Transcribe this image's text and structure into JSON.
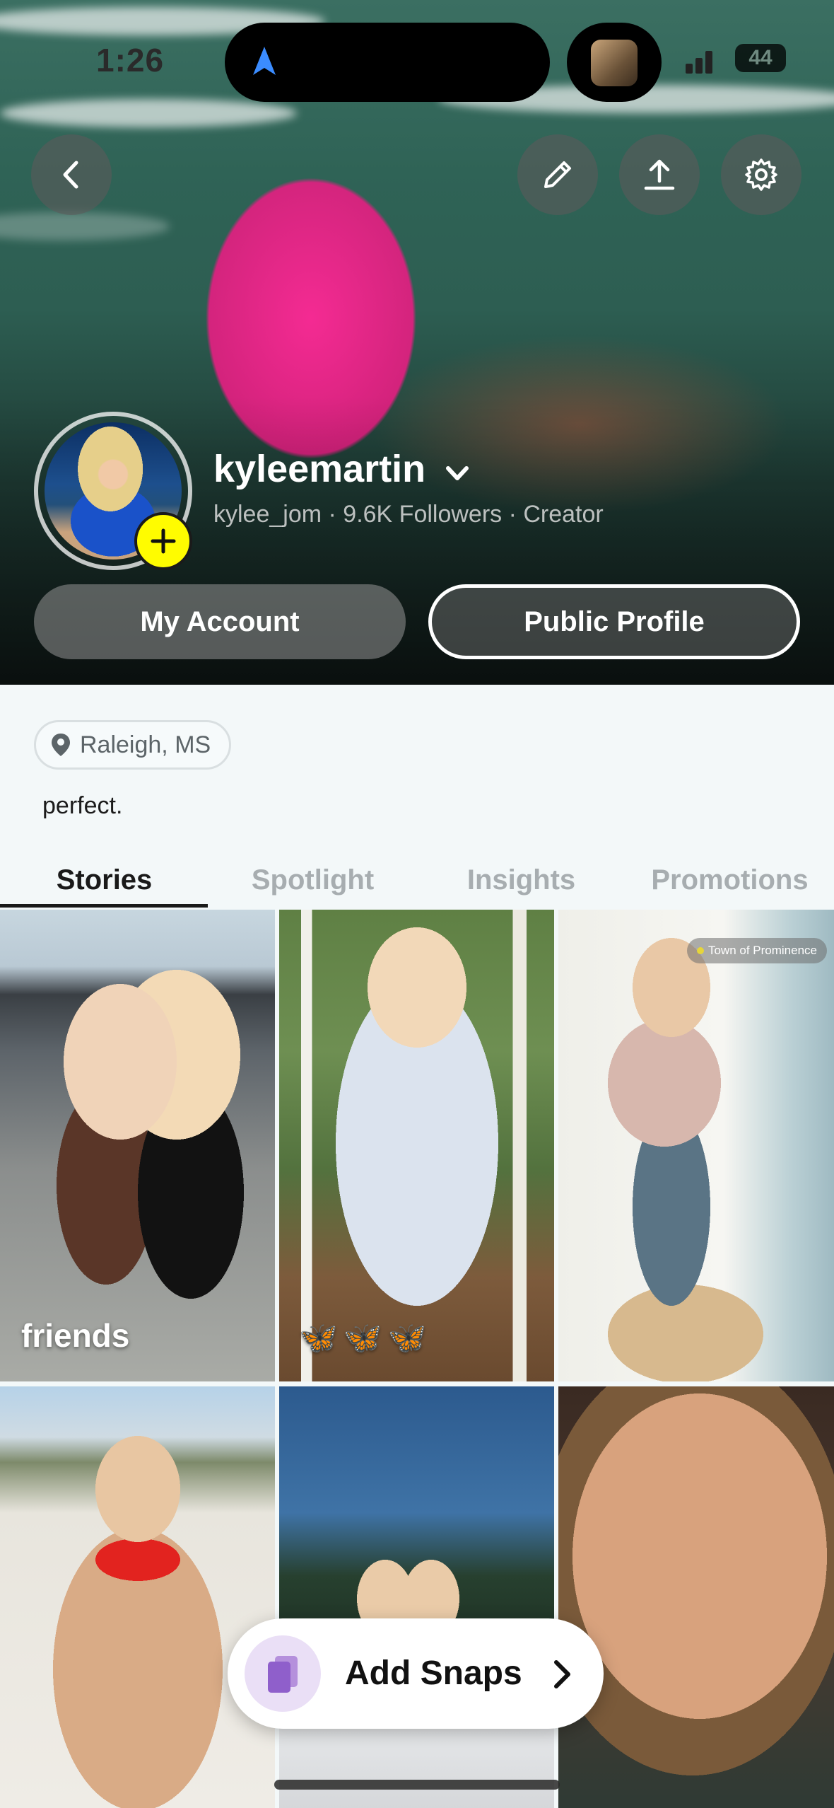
{
  "status_bar": {
    "time": "1:26",
    "battery": "44"
  },
  "profile": {
    "display_name": "kyleemartin",
    "meta": "kylee_jom · 9.6K Followers · Creator",
    "location": "Raleigh, MS",
    "bio": "perfect."
  },
  "actions": {
    "my_account": "My Account",
    "public_profile": "Public Profile"
  },
  "tabs": [
    {
      "label": "Stories",
      "active": true
    },
    {
      "label": "Spotlight",
      "active": false
    },
    {
      "label": "Insights",
      "active": false
    },
    {
      "label": "Promotions",
      "active": false
    }
  ],
  "stories": [
    {
      "caption": "friends"
    },
    {
      "caption": "🦋🦋🦋"
    },
    {
      "place_tag": "Town of Prominence"
    }
  ],
  "add_snaps": {
    "label": "Add Snaps"
  },
  "colors": {
    "accent_yellow": "#fffc00",
    "snap_icon": "#9b6ad0"
  },
  "icons": [
    "back-icon",
    "edit-icon",
    "share-icon",
    "gear-icon",
    "location-pin-icon",
    "plus-icon",
    "chevron-down-icon",
    "snap-stack-icon",
    "chevron-right-icon"
  ]
}
